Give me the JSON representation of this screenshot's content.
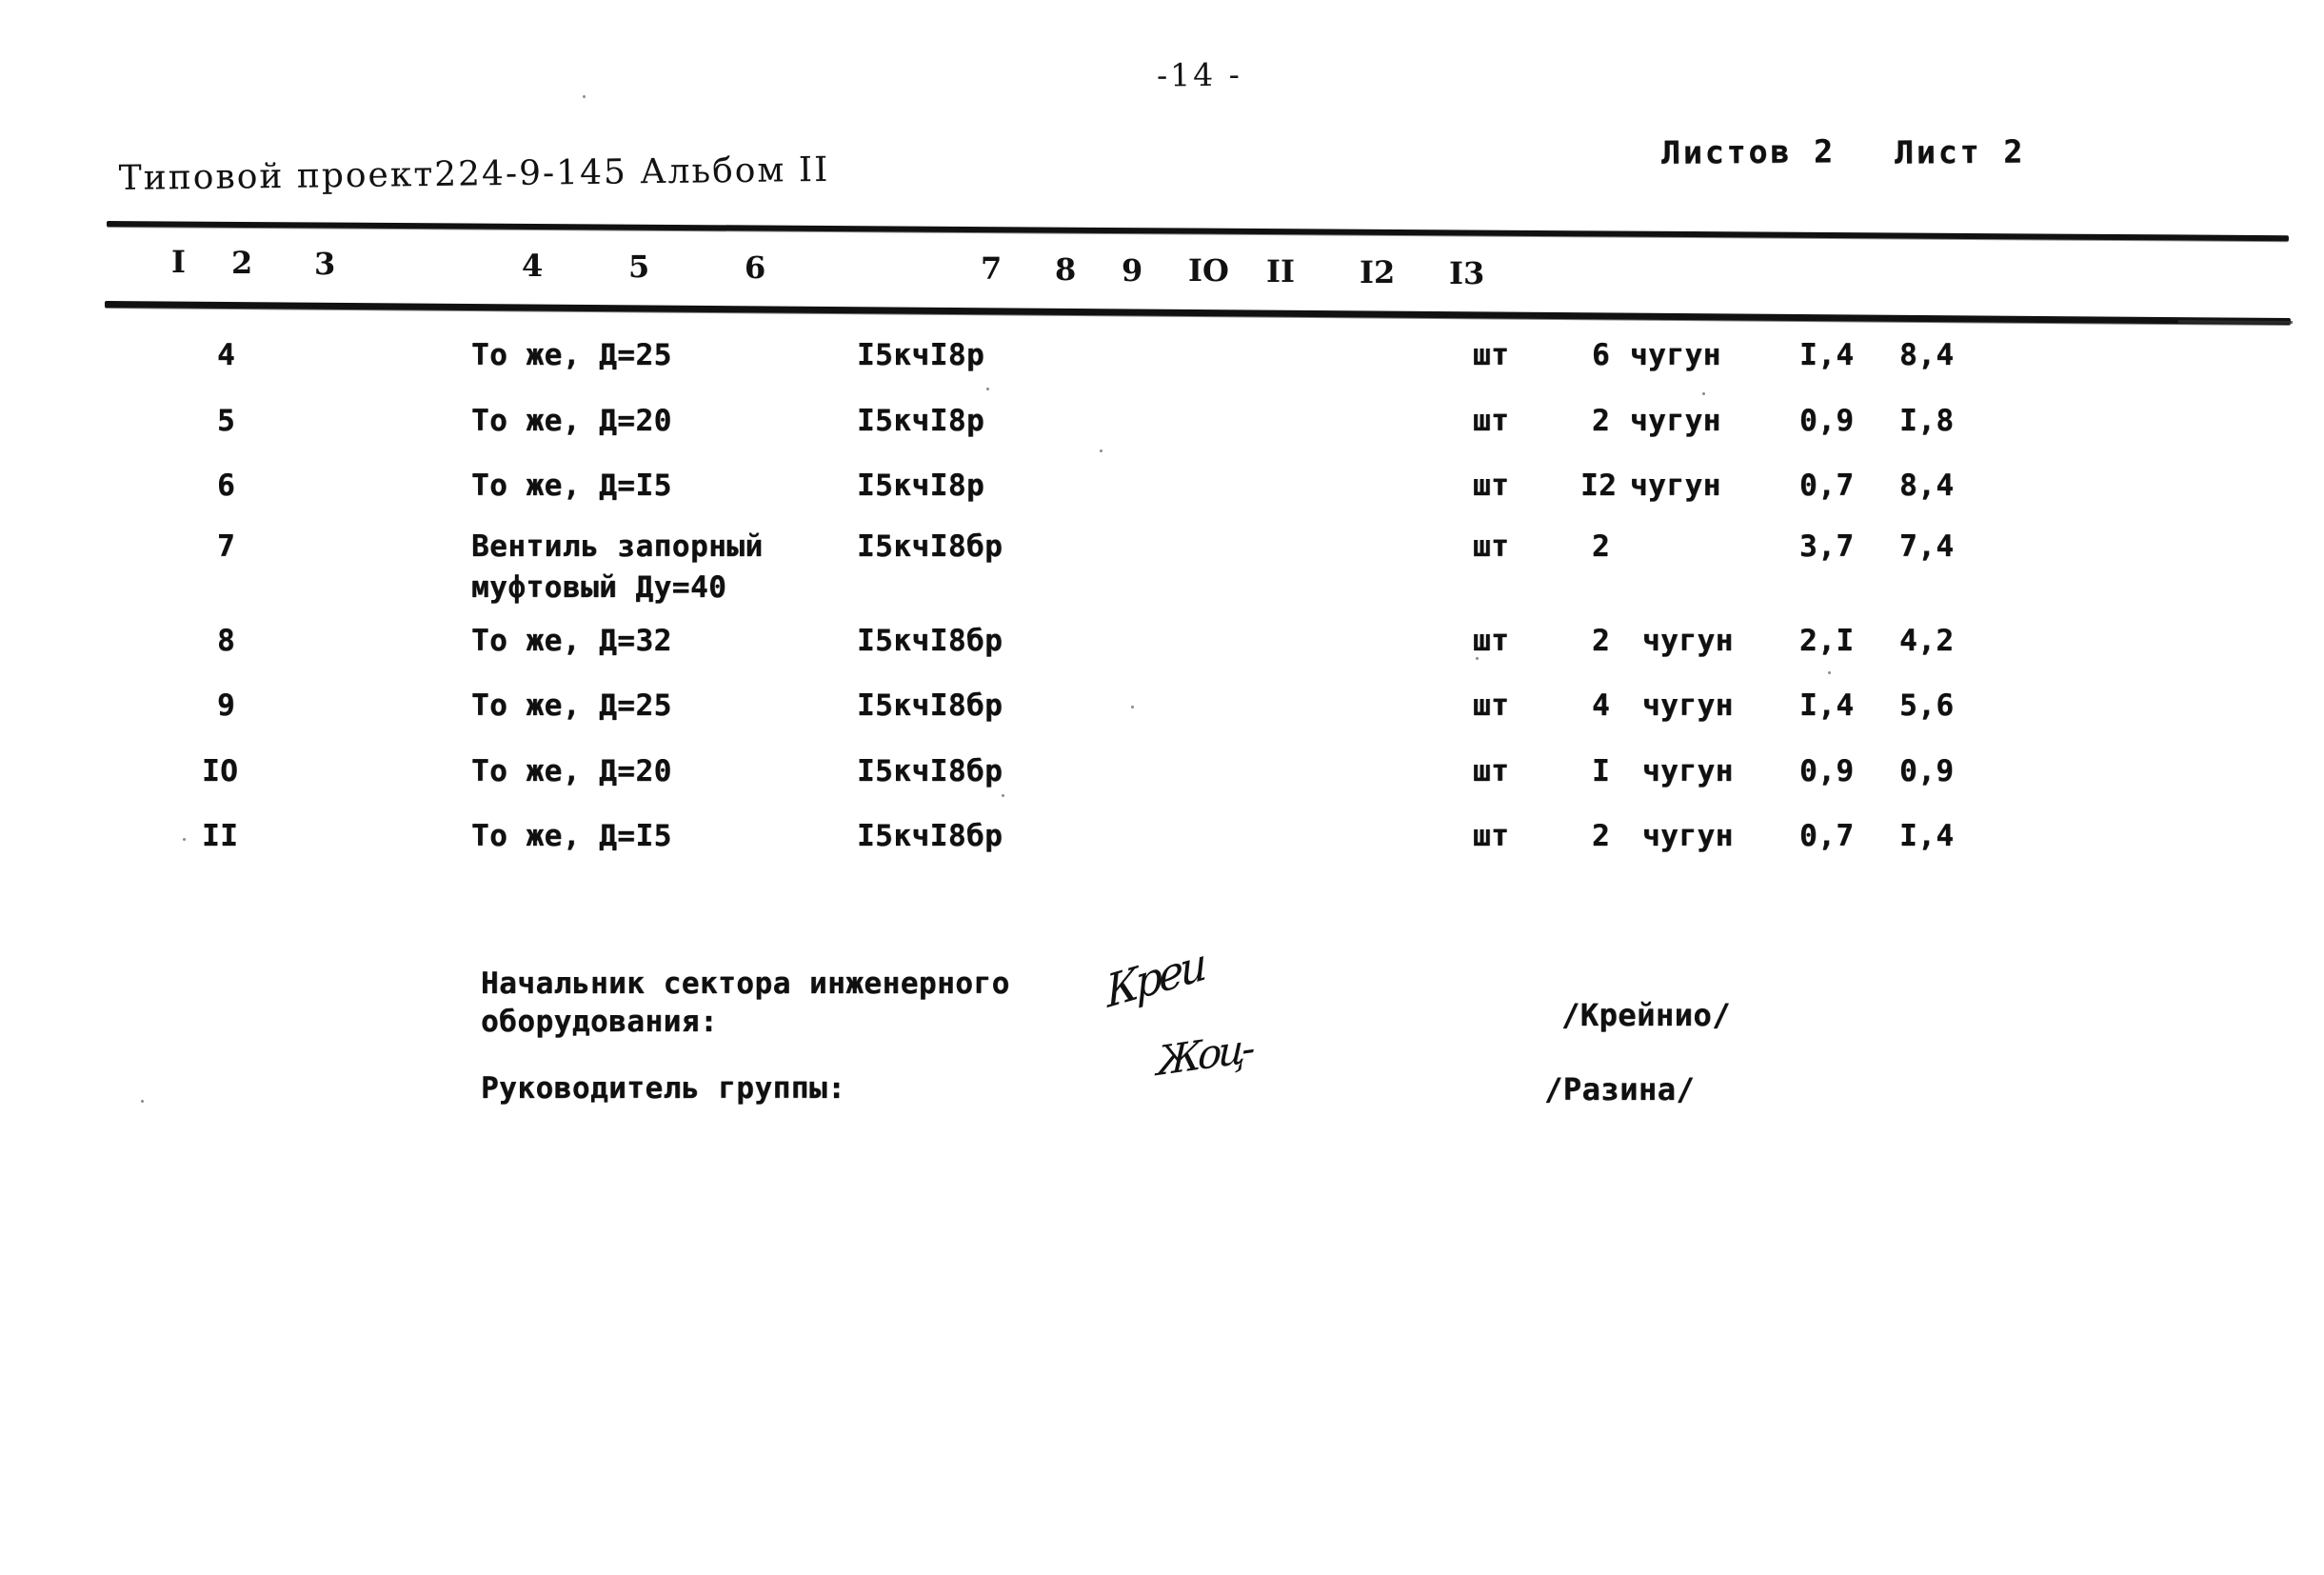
{
  "document": {
    "page_number": "-14 -",
    "project_line": "Типовой проект224-9-145 Альбом II",
    "sheets_label": "Листов 2",
    "sheet_label": "Лист 2"
  },
  "table": {
    "column_headers": [
      "I",
      "2",
      "3",
      "4",
      "5",
      "6",
      "7",
      "8",
      "9",
      "IO",
      "II",
      "I2",
      "I3"
    ],
    "rows": [
      {
        "num": "4",
        "name": "То же, Д=25",
        "name2": "",
        "mark": "I5кчI8р",
        "unit": "шт",
        "qty": "6",
        "material": "чугун",
        "mass_unit": "I,4",
        "mass_total": "8,4"
      },
      {
        "num": "5",
        "name": "То же, Д=20",
        "name2": "",
        "mark": "I5кчI8р",
        "unit": "шт",
        "qty": "2",
        "material": "чугун",
        "mass_unit": "0,9",
        "mass_total": "I,8"
      },
      {
        "num": "6",
        "name": "То же, Д=I5",
        "name2": "",
        "mark": "I5кчI8р",
        "unit": "шт",
        "qty": "I2",
        "material": "чугун",
        "mass_unit": "0,7",
        "mass_total": "8,4"
      },
      {
        "num": "7",
        "name": "Вентиль запорный",
        "name2": "муфтовый Ду=40",
        "mark": "I5кчI8бр",
        "unit": "шт",
        "qty": "2",
        "material": "",
        "mass_unit": "3,7",
        "mass_total": "7,4"
      },
      {
        "num": "8",
        "name": "То же, Д=32",
        "name2": "",
        "mark": "I5кчI8бр",
        "unit": "шт",
        "qty": "2",
        "material": "чугун",
        "mass_unit": "2,I",
        "mass_total": "4,2"
      },
      {
        "num": "9",
        "name": "То же, Д=25",
        "name2": "",
        "mark": "I5кчI8бр",
        "unit": "шт",
        "qty": "4",
        "material": "чугун",
        "mass_unit": "I,4",
        "mass_total": "5,6"
      },
      {
        "num": "IO",
        "name": "То же, Д=20",
        "name2": "",
        "mark": "I5кчI8бр",
        "unit": "шт",
        "qty": "I",
        "material": "чугун",
        "mass_unit": "0,9",
        "mass_total": "0,9"
      },
      {
        "num": "II",
        "name": "То же, Д=I5",
        "name2": "",
        "mark": "I5кчI8бр",
        "unit": "шт",
        "qty": "2",
        "material": "чугун",
        "mass_unit": "0,7",
        "mass_total": "I,4"
      }
    ]
  },
  "signatures": {
    "role1_line1": "Начальник сектора инженерного",
    "role1_line2": "оборудования:",
    "role2": "Руководитель группы:",
    "name1": "/Крейнио/",
    "name2": "/Разина/",
    "signature1_glyph": "Креи",
    "signature2_glyph": "Жоц-"
  }
}
